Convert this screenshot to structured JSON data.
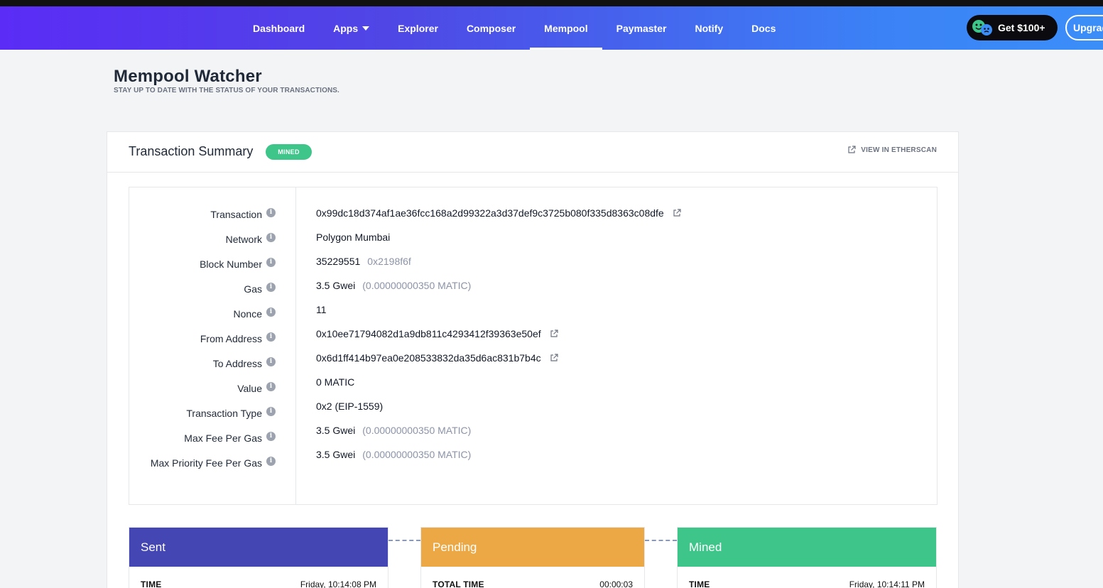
{
  "nav": {
    "items": [
      {
        "label": "Dashboard"
      },
      {
        "label": "Apps"
      },
      {
        "label": "Explorer"
      },
      {
        "label": "Composer"
      },
      {
        "label": "Mempool"
      },
      {
        "label": "Paymaster"
      },
      {
        "label": "Notify"
      },
      {
        "label": "Docs"
      }
    ],
    "active": "Mempool",
    "get_label": "Get $100+",
    "upgrade_label": "Upgrade"
  },
  "page": {
    "title": "Mempool Watcher",
    "subtitle": "STAY UP TO DATE WITH THE STATUS OF YOUR TRANSACTIONS."
  },
  "summary": {
    "title": "Transaction Summary",
    "status_badge": "MINED",
    "etherscan_label": "VIEW IN ETHERSCAN",
    "rows": [
      {
        "label": "Transaction",
        "value": "0x99dc18d374af1ae36fcc168a2d99322a3d37def9c3725b080f335d8363c08dfe",
        "extra": ""
      },
      {
        "label": "Network",
        "value": "Polygon Mumbai",
        "extra": ""
      },
      {
        "label": "Block Number",
        "value": "35229551",
        "extra": "0x2198f6f"
      },
      {
        "label": "Gas",
        "value": "3.5 Gwei",
        "extra": "(0.00000000350 MATIC)"
      },
      {
        "label": "Nonce",
        "value": "11",
        "extra": ""
      },
      {
        "label": "From Address",
        "value": "0x10ee71794082d1a9db811c4293412f39363e50ef",
        "extra": ""
      },
      {
        "label": "To Address",
        "value": "0x6d1ff414b97ea0e208533832da35d6ac831b7b4c",
        "extra": ""
      },
      {
        "label": "Value",
        "value": "0 MATIC",
        "extra": ""
      },
      {
        "label": "Transaction Type",
        "value": "0x2 (EIP-1559)",
        "extra": ""
      },
      {
        "label": "Max Fee Per Gas",
        "value": "3.5 Gwei",
        "extra": "(0.00000000350 MATIC)"
      },
      {
        "label": "Max Priority Fee Per Gas",
        "value": "3.5 Gwei",
        "extra": "(0.00000000350 MATIC)"
      }
    ]
  },
  "stages": [
    {
      "title": "Sent",
      "key": "TIME",
      "value": "Friday, 10:14:08 PM",
      "color": "#4346b3"
    },
    {
      "title": "Pending",
      "key": "TOTAL TIME",
      "value": "00:00:03",
      "color": "#eba844"
    },
    {
      "title": "Mined",
      "key": "TIME",
      "value": "Friday, 10:14:11 PM",
      "color": "#3ec68a"
    }
  ],
  "colors": {
    "accent_purple": "#5b2cf6",
    "accent_blue": "#3b8ef8",
    "mined_green": "#3ec68a"
  },
  "icons": [
    "info-icon",
    "external-link-icon",
    "caret-down-icon",
    "faces-icon"
  ]
}
